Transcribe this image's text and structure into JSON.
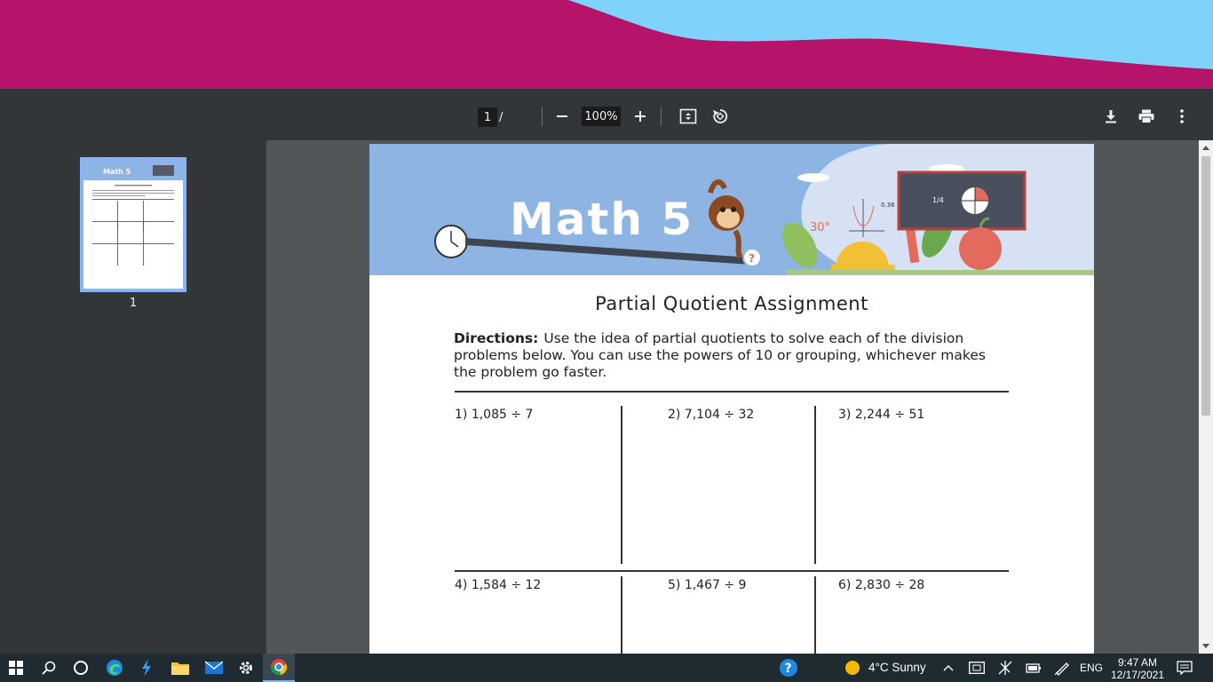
{
  "toolbar": {
    "page_current": "1",
    "page_separator": "/",
    "zoom_value": "100%"
  },
  "sidebar": {
    "thumbnail_page_number": "1",
    "thumbnail_banner_text": "Math 5"
  },
  "document": {
    "banner_title": "Math 5",
    "banner_annotations": {
      "angle": "30°",
      "decimal": "0.36",
      "fraction_board": "1/4"
    },
    "title": "Partial Quotient Assignment",
    "directions_label": "Directions:",
    "directions_text": "Use the idea of partial quotients to solve each of the division problems below. You can use the powers of 10 or grouping, whichever makes the problem go faster.",
    "problems": [
      "1) 1,085 ÷ 7",
      "2) 7,104 ÷ 32",
      "3) 2,244 ÷ 51",
      "4) 1,584 ÷ 12",
      "5) 1,467 ÷ 9",
      "6) 2,830 ÷ 28"
    ]
  },
  "taskbar": {
    "weather": "4°C  Sunny",
    "language": "ENG",
    "time": "9:47 AM",
    "date": "12/17/2021"
  },
  "colors": {
    "scribble": "#b5146a",
    "sky": "#7fd3fb",
    "toolbar_bg": "#323639",
    "viewer_bg": "#525659",
    "banner_bg": "#8db4e2",
    "thumb_highlight": "#8ab4f8",
    "taskbar_bg": "#1f2a31"
  }
}
